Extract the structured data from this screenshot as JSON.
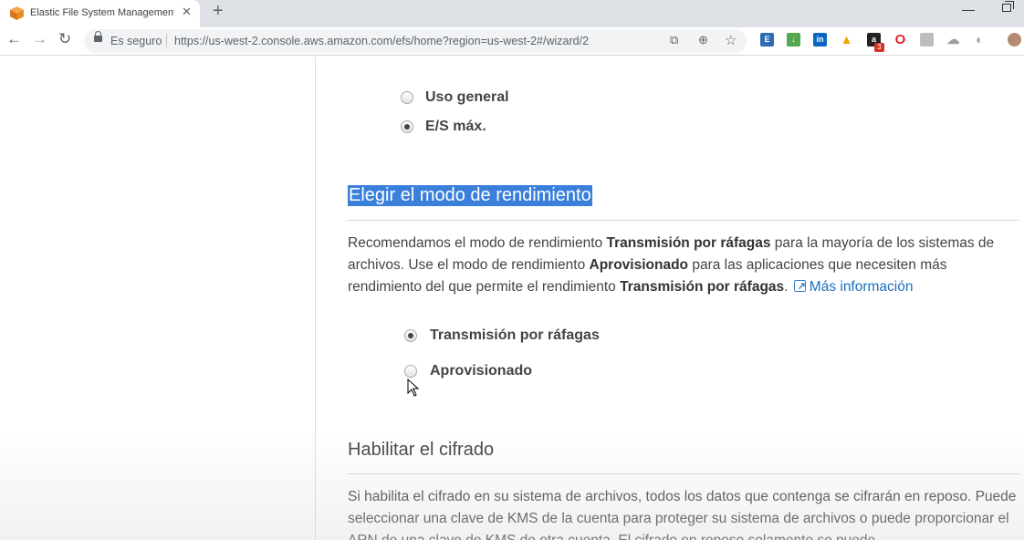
{
  "browser": {
    "tab_title": "Elastic File System Management C",
    "secure_label": "Es seguro",
    "url": "https://us-west-2.console.aws.amazon.com/efs/home?region=us-west-2#/wizard/2",
    "ext_badge_count": "3"
  },
  "performance_mode": {
    "options": [
      {
        "label": "Uso general",
        "selected": false
      },
      {
        "label": "E/S máx.",
        "selected": true
      }
    ]
  },
  "throughput_mode": {
    "heading": "Elegir el modo de rendimiento",
    "desc_1": "Recomendamos el modo de rendimiento ",
    "desc_bold_1": "Transmisión por ráfagas",
    "desc_2": " para la mayoría de los sistemas de archivos. Use el modo de rendimiento ",
    "desc_bold_2": "Aprovisionado",
    "desc_3": " para las aplicaciones que necesiten más rendimiento del que permite el rendimiento ",
    "desc_bold_3": "Transmisión por ráfagas",
    "desc_4": ".",
    "more_info_link": "Más información",
    "options": [
      {
        "label": "Transmisión por ráfagas",
        "selected": true
      },
      {
        "label": "Aprovisionado",
        "selected": false
      }
    ]
  },
  "encryption": {
    "heading": "Habilitar el cifrado",
    "desc": "Si habilita el cifrado en su sistema de archivos, todos los datos que contenga se cifrarán en reposo. Puede seleccionar una clave de KMS de la cuenta para proteger su sistema de archivos o puede proporcionar el ARN de una clave de KMS de otra cuenta. El cifrado en reposo solamente se puede"
  },
  "colors": {
    "highlight": "#3a7fd9",
    "link": "#1a6fc0"
  }
}
